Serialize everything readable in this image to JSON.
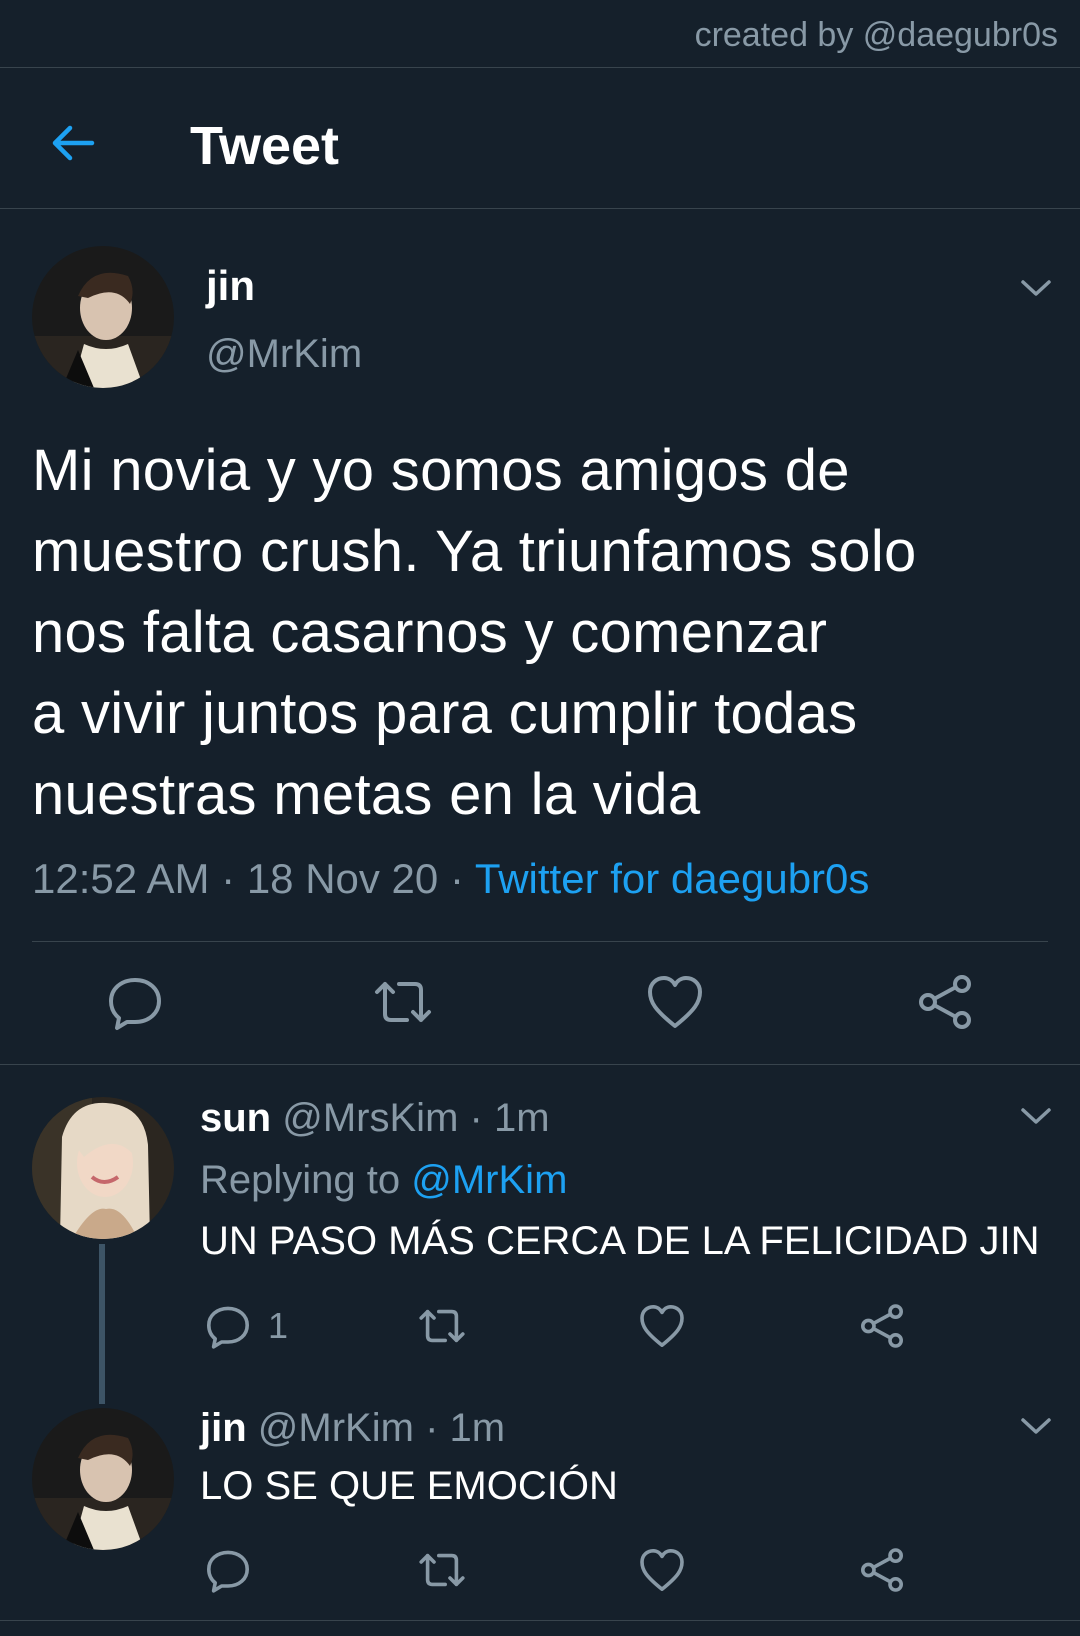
{
  "watermark": "created by @daegubr0s",
  "header": {
    "title": "Tweet"
  },
  "tweet": {
    "name": "jin",
    "handle": "@MrKim",
    "text": "Mi novia y yo somos amigos de muestro crush. Ya triunfamos solo nos falta casarnos y comenzar a vivir juntos para cumplir todas nuestras metas en la vida",
    "lines": [
      "Mi novia y yo somos amigos de",
      "muestro crush. Ya triunfamos solo",
      "nos falta casarnos y comenzar",
      "a vivir juntos para cumplir todas",
      "nuestras metas en la vida"
    ],
    "time": "12:52 AM",
    "date": "18 Nov 20",
    "separator": "·",
    "source": "Twitter for daegubr0s",
    "icons": [
      "reply-icon",
      "retweet-icon",
      "like-icon",
      "share-icon"
    ]
  },
  "replies": [
    {
      "name": "sun",
      "handle": "@MrsKim",
      "time_ago": "1m",
      "separator": "·",
      "replying_prefix": "Replying to",
      "replying_to": "@MrKim",
      "text": "UN PASO MÁS CERCA DE LA FELICIDAD JIN",
      "reply_count": "1"
    },
    {
      "name": "jin",
      "handle": "@MrKim",
      "time_ago": "1m",
      "separator": "·",
      "text": "LO SE QUE EMOCIÓN"
    }
  ],
  "colors": {
    "background": "#15202b",
    "divider": "#38444d",
    "secondary_text": "#8899a6",
    "accent": "#1da1f2",
    "thread_line": "#3d5466"
  }
}
